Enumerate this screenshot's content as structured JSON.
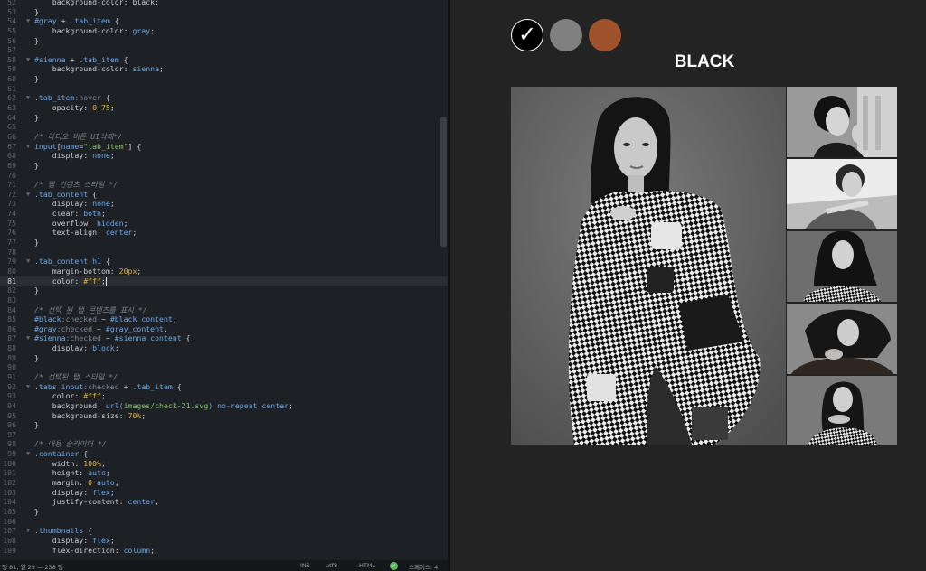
{
  "editor": {
    "lines": [
      {
        "n": "52",
        "fold": "",
        "segs": [
          [
            "t-plain",
            "    background-color: black;"
          ]
        ]
      },
      {
        "n": "53",
        "fold": "",
        "segs": [
          [
            "t-plain",
            "}"
          ]
        ]
      },
      {
        "n": "54",
        "fold": "▼",
        "segs": [
          [
            "t-sel",
            "#gray"
          ],
          [
            "t-plain",
            " + "
          ],
          [
            "t-sel",
            ".tab_item"
          ],
          [
            "t-plain",
            " {"
          ]
        ]
      },
      {
        "n": "55",
        "fold": "",
        "segs": [
          [
            "t-prop",
            "    background-color: "
          ],
          [
            "t-val",
            "gray"
          ],
          [
            "t-plain",
            ";"
          ]
        ]
      },
      {
        "n": "56",
        "fold": "",
        "segs": [
          [
            "t-plain",
            "}"
          ]
        ]
      },
      {
        "n": "57",
        "fold": "",
        "segs": [
          [
            "t-plain",
            ""
          ]
        ]
      },
      {
        "n": "58",
        "fold": "▼",
        "segs": [
          [
            "t-sel",
            "#sienna"
          ],
          [
            "t-plain",
            " + "
          ],
          [
            "t-sel",
            ".tab_item"
          ],
          [
            "t-plain",
            " {"
          ]
        ]
      },
      {
        "n": "59",
        "fold": "",
        "segs": [
          [
            "t-prop",
            "    background-color: "
          ],
          [
            "t-val",
            "sienna"
          ],
          [
            "t-plain",
            ";"
          ]
        ]
      },
      {
        "n": "60",
        "fold": "",
        "segs": [
          [
            "t-plain",
            "}"
          ]
        ]
      },
      {
        "n": "61",
        "fold": "",
        "segs": [
          [
            "t-plain",
            ""
          ]
        ]
      },
      {
        "n": "62",
        "fold": "▼",
        "segs": [
          [
            "t-sel",
            ".tab_item"
          ],
          [
            "t-pseudo",
            ":hover"
          ],
          [
            "t-plain",
            " {"
          ]
        ]
      },
      {
        "n": "63",
        "fold": "",
        "segs": [
          [
            "t-prop",
            "    opacity: "
          ],
          [
            "t-num",
            "0.75"
          ],
          [
            "t-plain",
            ";"
          ]
        ]
      },
      {
        "n": "64",
        "fold": "",
        "segs": [
          [
            "t-plain",
            "}"
          ]
        ]
      },
      {
        "n": "65",
        "fold": "",
        "segs": [
          [
            "t-plain",
            ""
          ]
        ]
      },
      {
        "n": "66",
        "fold": "",
        "segs": [
          [
            "t-cmt",
            "/* 라디오 버튼 UI삭제*/"
          ]
        ]
      },
      {
        "n": "67",
        "fold": "▼",
        "segs": [
          [
            "t-sel",
            "input"
          ],
          [
            "t-plain",
            "["
          ],
          [
            "t-sel",
            "name"
          ],
          [
            "t-plain",
            "="
          ],
          [
            "t-str",
            "\"tab_item\""
          ],
          [
            "t-plain",
            "] {"
          ]
        ]
      },
      {
        "n": "68",
        "fold": "",
        "segs": [
          [
            "t-prop",
            "    display: "
          ],
          [
            "t-val",
            "none"
          ],
          [
            "t-plain",
            ";"
          ]
        ]
      },
      {
        "n": "69",
        "fold": "",
        "segs": [
          [
            "t-plain",
            "}"
          ]
        ]
      },
      {
        "n": "70",
        "fold": "",
        "segs": [
          [
            "t-plain",
            ""
          ]
        ]
      },
      {
        "n": "71",
        "fold": "",
        "segs": [
          [
            "t-cmt",
            "/* 탭 컨텐츠 스타일 */"
          ]
        ]
      },
      {
        "n": "72",
        "fold": "▼",
        "segs": [
          [
            "t-sel",
            ".tab_content"
          ],
          [
            "t-plain",
            " {"
          ]
        ]
      },
      {
        "n": "73",
        "fold": "",
        "segs": [
          [
            "t-prop",
            "    display: "
          ],
          [
            "t-val",
            "none"
          ],
          [
            "t-plain",
            ";"
          ]
        ]
      },
      {
        "n": "74",
        "fold": "",
        "segs": [
          [
            "t-prop",
            "    clear: "
          ],
          [
            "t-val",
            "both"
          ],
          [
            "t-plain",
            ";"
          ]
        ]
      },
      {
        "n": "75",
        "fold": "",
        "segs": [
          [
            "t-prop",
            "    overflow: "
          ],
          [
            "t-val",
            "hidden"
          ],
          [
            "t-plain",
            ";"
          ]
        ]
      },
      {
        "n": "76",
        "fold": "",
        "segs": [
          [
            "t-prop",
            "    text-align: "
          ],
          [
            "t-val",
            "center"
          ],
          [
            "t-plain",
            ";"
          ]
        ]
      },
      {
        "n": "77",
        "fold": "",
        "segs": [
          [
            "t-plain",
            "}"
          ]
        ]
      },
      {
        "n": "78",
        "fold": "",
        "segs": [
          [
            "t-plain",
            ""
          ]
        ]
      },
      {
        "n": "79",
        "fold": "▼",
        "segs": [
          [
            "t-sel",
            ".tab_content h1"
          ],
          [
            "t-plain",
            " {"
          ]
        ]
      },
      {
        "n": "80",
        "fold": "",
        "segs": [
          [
            "t-prop",
            "    margin-bottom: "
          ],
          [
            "t-num",
            "20px"
          ],
          [
            "t-plain",
            ";"
          ]
        ]
      },
      {
        "n": "81",
        "fold": "",
        "active": true,
        "segs": [
          [
            "t-prop",
            "    color: "
          ],
          [
            "t-num",
            "#fff"
          ],
          [
            "t-plain",
            ";"
          ]
        ]
      },
      {
        "n": "82",
        "fold": "",
        "segs": [
          [
            "t-plain",
            "}"
          ]
        ]
      },
      {
        "n": "83",
        "fold": "",
        "segs": [
          [
            "t-plain",
            ""
          ]
        ]
      },
      {
        "n": "84",
        "fold": "",
        "segs": [
          [
            "t-cmt",
            "/* 선택 된 탭 콘텐츠를 표시 */"
          ]
        ]
      },
      {
        "n": "85",
        "fold": "",
        "segs": [
          [
            "t-sel",
            "#black"
          ],
          [
            "t-pseudo",
            ":checked"
          ],
          [
            "t-plain",
            " ~ "
          ],
          [
            "t-sel",
            "#black_content"
          ],
          [
            "t-plain",
            ","
          ]
        ]
      },
      {
        "n": "86",
        "fold": "",
        "segs": [
          [
            "t-sel",
            "#gray"
          ],
          [
            "t-pseudo",
            ":checked"
          ],
          [
            "t-plain",
            " ~ "
          ],
          [
            "t-sel",
            "#gray_content"
          ],
          [
            "t-plain",
            ","
          ]
        ]
      },
      {
        "n": "87",
        "fold": "▼",
        "segs": [
          [
            "t-sel",
            "#sienna"
          ],
          [
            "t-pseudo",
            ":checked"
          ],
          [
            "t-plain",
            " ~ "
          ],
          [
            "t-sel",
            "#sienna_content"
          ],
          [
            "t-plain",
            " {"
          ]
        ]
      },
      {
        "n": "88",
        "fold": "",
        "segs": [
          [
            "t-prop",
            "    display: "
          ],
          [
            "t-val",
            "block"
          ],
          [
            "t-plain",
            ";"
          ]
        ]
      },
      {
        "n": "89",
        "fold": "",
        "segs": [
          [
            "t-plain",
            "}"
          ]
        ]
      },
      {
        "n": "90",
        "fold": "",
        "segs": [
          [
            "t-plain",
            ""
          ]
        ]
      },
      {
        "n": "91",
        "fold": "",
        "segs": [
          [
            "t-cmt",
            "/* 선택된 탭 스타일 */"
          ]
        ]
      },
      {
        "n": "92",
        "fold": "▼",
        "segs": [
          [
            "t-sel",
            ".tabs input"
          ],
          [
            "t-pseudo",
            ":checked"
          ],
          [
            "t-plain",
            " + "
          ],
          [
            "t-sel",
            ".tab_item"
          ],
          [
            "t-plain",
            " {"
          ]
        ]
      },
      {
        "n": "93",
        "fold": "",
        "segs": [
          [
            "t-prop",
            "    color: "
          ],
          [
            "t-num",
            "#fff"
          ],
          [
            "t-plain",
            ";"
          ]
        ]
      },
      {
        "n": "94",
        "fold": "",
        "segs": [
          [
            "t-prop",
            "    background: "
          ],
          [
            "t-val",
            "url("
          ],
          [
            "t-str",
            "images/check-21.svg"
          ],
          [
            "t-val",
            ") no-repeat center"
          ],
          [
            "t-plain",
            ";"
          ]
        ]
      },
      {
        "n": "95",
        "fold": "",
        "segs": [
          [
            "t-prop",
            "    background-size: "
          ],
          [
            "t-num",
            "70%"
          ],
          [
            "t-plain",
            ";"
          ]
        ]
      },
      {
        "n": "96",
        "fold": "",
        "segs": [
          [
            "t-plain",
            "}"
          ]
        ]
      },
      {
        "n": "97",
        "fold": "",
        "segs": [
          [
            "t-plain",
            ""
          ]
        ]
      },
      {
        "n": "98",
        "fold": "",
        "segs": [
          [
            "t-cmt",
            "/* 내용 슬라이더 */"
          ]
        ]
      },
      {
        "n": "99",
        "fold": "▼",
        "segs": [
          [
            "t-sel",
            ".container"
          ],
          [
            "t-plain",
            " {"
          ]
        ]
      },
      {
        "n": "100",
        "fold": "",
        "segs": [
          [
            "t-prop",
            "    width: "
          ],
          [
            "t-num",
            "100%"
          ],
          [
            "t-plain",
            ";"
          ]
        ]
      },
      {
        "n": "101",
        "fold": "",
        "segs": [
          [
            "t-prop",
            "    height: "
          ],
          [
            "t-val",
            "auto"
          ],
          [
            "t-plain",
            ";"
          ]
        ]
      },
      {
        "n": "102",
        "fold": "",
        "segs": [
          [
            "t-prop",
            "    margin: "
          ],
          [
            "t-num",
            "0"
          ],
          [
            "t-val",
            " auto"
          ],
          [
            "t-plain",
            ";"
          ]
        ]
      },
      {
        "n": "103",
        "fold": "",
        "segs": [
          [
            "t-prop",
            "    display: "
          ],
          [
            "t-val",
            "flex"
          ],
          [
            "t-plain",
            ";"
          ]
        ]
      },
      {
        "n": "104",
        "fold": "",
        "segs": [
          [
            "t-prop",
            "    justify-content: "
          ],
          [
            "t-val",
            "center"
          ],
          [
            "t-plain",
            ";"
          ]
        ]
      },
      {
        "n": "105",
        "fold": "",
        "segs": [
          [
            "t-plain",
            "}"
          ]
        ]
      },
      {
        "n": "106",
        "fold": "",
        "segs": [
          [
            "t-plain",
            ""
          ]
        ]
      },
      {
        "n": "107",
        "fold": "▼",
        "segs": [
          [
            "t-sel",
            ".thumbnails"
          ],
          [
            "t-plain",
            " {"
          ]
        ]
      },
      {
        "n": "108",
        "fold": "",
        "segs": [
          [
            "t-prop",
            "    display: "
          ],
          [
            "t-val",
            "flex"
          ],
          [
            "t-plain",
            ";"
          ]
        ]
      },
      {
        "n": "109",
        "fold": "",
        "segs": [
          [
            "t-prop",
            "    flex-direction: "
          ],
          [
            "t-val",
            "column"
          ],
          [
            "t-plain",
            ";"
          ]
        ]
      }
    ]
  },
  "statusbar": {
    "position": "행 81, 열 29 — 238 행",
    "mode": "INS",
    "encoding": "utf8",
    "syntax": "HTML",
    "ok_glyph": "✓",
    "indent": "스페이스: 4"
  },
  "preview": {
    "tabs": [
      {
        "color": "#000000",
        "check_glyph": "✓"
      },
      {
        "color": "#808080"
      },
      {
        "color": "#a0522d"
      }
    ],
    "heading": "BLACK"
  }
}
